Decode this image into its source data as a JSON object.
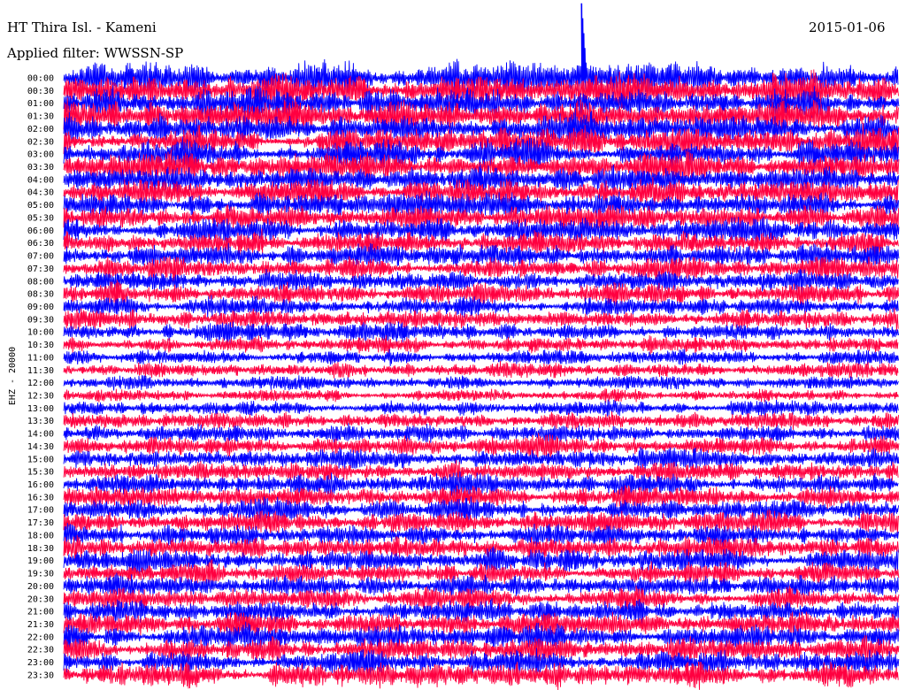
{
  "header": {
    "station": "HT Thira Isl. - Kameni",
    "date": "2015-01-06",
    "filter_label": "Applied filter: WWSSN-SP"
  },
  "colors": {
    "trace_a": "#0000ff",
    "trace_b": "#ff0040",
    "background": "#ffffff",
    "text": "#000000"
  },
  "chart_data": {
    "type": "helicorder",
    "title": "HT Thira Isl. - Kameni",
    "date": "2015-01-06",
    "filter": "Applied filter: WWSSN-SP",
    "ylabel": "EHZ - 20000",
    "xlabel": "",
    "grid": false,
    "line_duration_minutes": 30,
    "series_colors_alternating": [
      "#0000ff",
      "#ff0040"
    ],
    "row_labels": [
      "00:00",
      "00:30",
      "01:00",
      "01:30",
      "02:00",
      "02:30",
      "03:00",
      "03:30",
      "04:00",
      "04:30",
      "05:00",
      "05:30",
      "06:00",
      "06:30",
      "07:00",
      "07:30",
      "08:00",
      "08:30",
      "09:00",
      "09:30",
      "10:00",
      "10:30",
      "11:00",
      "11:30",
      "12:00",
      "12:30",
      "13:00",
      "13:30",
      "14:00",
      "14:30",
      "15:00",
      "15:30",
      "16:00",
      "16:30",
      "17:00",
      "17:30",
      "18:00",
      "18:30",
      "19:00",
      "19:30",
      "20:00",
      "20:30",
      "21:00",
      "21:30",
      "22:00",
      "22:30",
      "23:00",
      "23:30"
    ],
    "relative_noise_level": [
      1.9,
      1.9,
      1.8,
      1.8,
      1.8,
      1.7,
      1.7,
      1.7,
      1.6,
      1.6,
      1.5,
      1.5,
      1.4,
      1.4,
      1.3,
      1.3,
      1.2,
      1.2,
      1.1,
      1.1,
      1.0,
      0.95,
      0.9,
      0.85,
      0.8,
      0.7,
      0.9,
      1.0,
      1.05,
      1.1,
      1.15,
      1.2,
      1.2,
      1.2,
      1.25,
      1.25,
      1.3,
      1.3,
      1.3,
      1.3,
      1.35,
      1.35,
      1.35,
      1.35,
      1.4,
      1.4,
      1.4,
      1.45
    ],
    "events": [
      {
        "row_label": "00:00",
        "time_fraction": 0.62,
        "relative_amplitude": 9.0
      }
    ]
  }
}
